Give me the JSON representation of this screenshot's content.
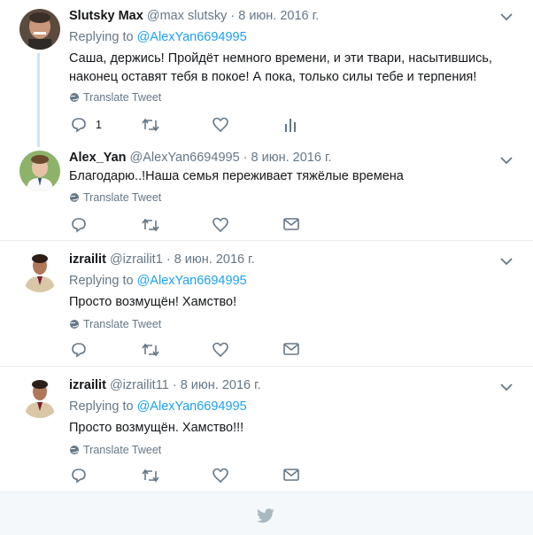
{
  "tweets": [
    {
      "name": "Slutsky Max",
      "handle": "@max slutsky",
      "dot": "·",
      "date": "8 июн. 2016 г.",
      "replying_prefix": "Replying to",
      "replying_to": "@AlexYan6694995",
      "text_line1": "Саша, держись! Пройдёт немного времени, и эти твари, насытившись,",
      "text_line2": "наконец оставят тебя в покое! А пока, только силы тебе и терпения!",
      "translate": "Translate Tweet",
      "reply_count": "1"
    },
    {
      "name": "Alex_Yan",
      "handle": "@AlexYan6694995",
      "dot": "·",
      "date": "8 июн. 2016 г.",
      "text": "Благодарю..!Наша семья переживает тяжёлые времена",
      "translate": "Translate Tweet"
    },
    {
      "name": "izrailit",
      "handle": "@izrailit1",
      "dot": "·",
      "date": "8 июн. 2016 г.",
      "replying_prefix": "Replying to",
      "replying_to": "@AlexYan6694995",
      "text": "Просто возмущён! Хамство!",
      "translate": "Translate Tweet"
    },
    {
      "name": "izrailit",
      "handle": "@izrailit11",
      "dot": "·",
      "date": "8 июн. 2016 г.",
      "replying_prefix": "Replying to",
      "replying_to": "@AlexYan6694995",
      "text": "Просто возмущён. Хамство!!!",
      "translate": "Translate Tweet"
    }
  ],
  "colors": {
    "link": "#1da1f2",
    "muted": "#657786",
    "thread": "#c4e8fb"
  },
  "icons": [
    "globe-icon",
    "reply-icon",
    "retweet-icon",
    "like-icon",
    "analytics-icon",
    "message-icon",
    "caret-down-icon",
    "twitter-bird-icon"
  ]
}
